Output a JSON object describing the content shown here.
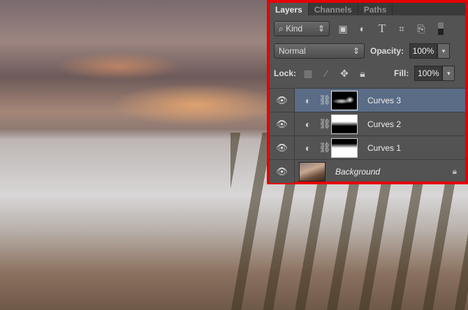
{
  "panel": {
    "tabs": [
      "Layers",
      "Channels",
      "Paths"
    ],
    "filter": {
      "label": "Kind",
      "icons": [
        "image-filter-icon",
        "adjustment-filter-icon",
        "type-filter-icon",
        "shape-filter-icon",
        "smart-object-filter-icon",
        "filter-toggle-icon"
      ]
    },
    "blend_mode": "Normal",
    "opacity_label": "Opacity:",
    "opacity": "100%",
    "lock_label": "Lock:",
    "fill_label": "Fill:",
    "fill": "100%",
    "layers": [
      {
        "name": "Curves 3",
        "selected": true
      },
      {
        "name": "Curves 2"
      },
      {
        "name": "Curves 1"
      },
      {
        "name": "Background",
        "locked": true
      }
    ]
  }
}
